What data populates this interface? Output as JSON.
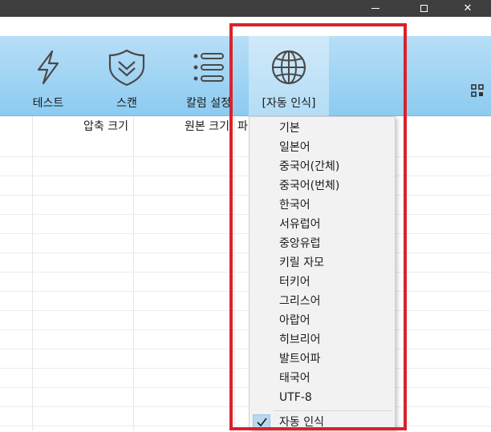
{
  "window": {
    "controls": [
      "minimize",
      "maximize",
      "close"
    ],
    "close_glyph": "✕"
  },
  "toolbar": {
    "buttons": [
      {
        "label": "테스트",
        "icon": "lightning-icon"
      },
      {
        "label": "스캔",
        "icon": "shield-chevron-icon"
      },
      {
        "label": "칼럼 설정",
        "icon": "list-icon"
      },
      {
        "label": "[자동 인식]",
        "icon": "globe-icon",
        "active": true
      }
    ],
    "right_icon": "grid-icon"
  },
  "table": {
    "headers": [
      "압축 크기",
      "원본 크기",
      "파"
    ]
  },
  "encoding_menu": {
    "items": [
      {
        "label": "기본"
      },
      {
        "label": "일본어"
      },
      {
        "label": "중국어(간체)"
      },
      {
        "label": "중국어(번체)"
      },
      {
        "label": "한국어"
      },
      {
        "label": "서유럽어"
      },
      {
        "label": "중앙유럽"
      },
      {
        "label": "키릴 자모"
      },
      {
        "label": "터키어"
      },
      {
        "label": "그리스어"
      },
      {
        "label": "아랍어"
      },
      {
        "label": "히브리어"
      },
      {
        "label": "발트어파"
      },
      {
        "label": "태국어"
      },
      {
        "label": "UTF-8"
      }
    ],
    "checked_item": {
      "label": "자동 인식",
      "checked": true
    }
  },
  "colors": {
    "toolbar_top": "#b7def7",
    "toolbar_bottom": "#8ccbf0",
    "highlight_border": "#d9222b",
    "titlebar": "#3f3f3f"
  }
}
